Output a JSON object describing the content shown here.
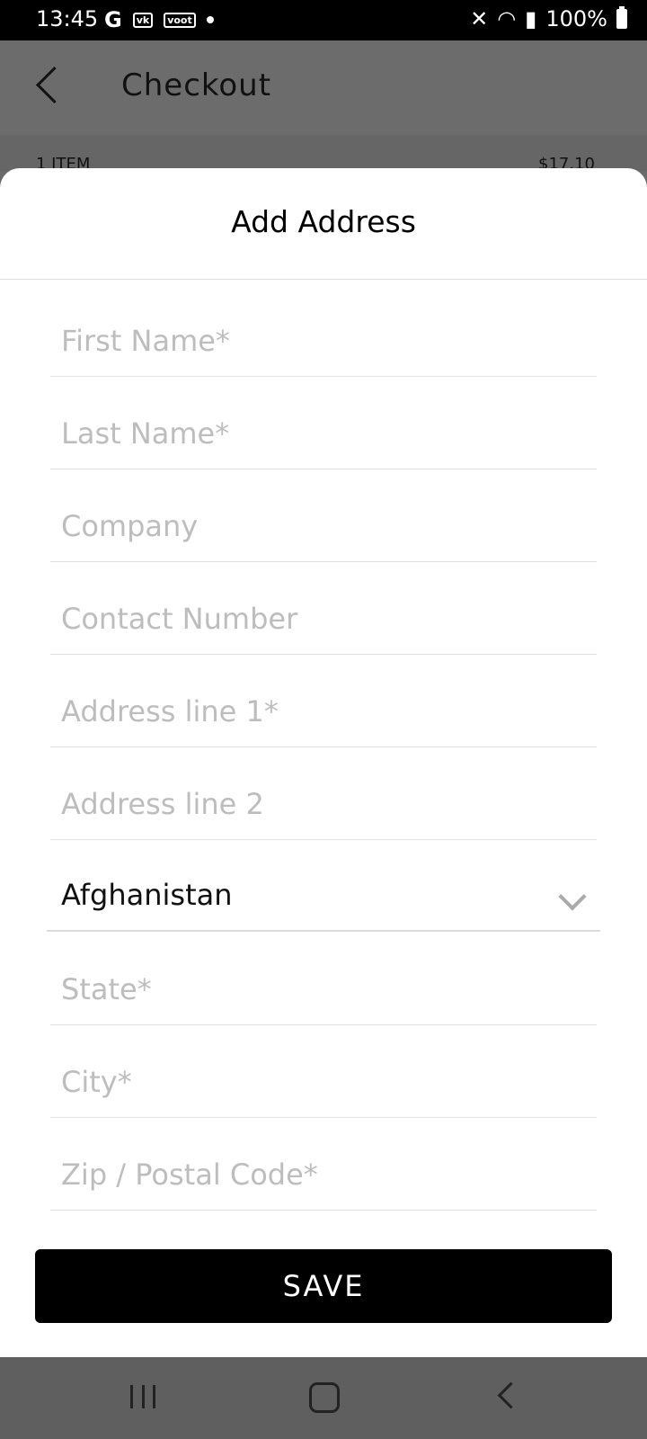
{
  "status_bar": {
    "time": "13:45",
    "left_icons": [
      "G",
      "vk",
      "voot"
    ],
    "battery": "100%"
  },
  "header": {
    "title": "Checkout",
    "behind_left": "1 ITEM",
    "behind_right": "$17.10"
  },
  "sheet": {
    "title": "Add Address",
    "fields": {
      "first_name": "First Name*",
      "last_name": "Last Name*",
      "company": "Company",
      "contact": "Contact Number",
      "address1": "Address line 1*",
      "address2": "Address line 2",
      "state": "State*",
      "city": "City*",
      "zip": "Zip / Postal Code*"
    },
    "country": "Afghanistan",
    "save_label": "SAVE"
  }
}
